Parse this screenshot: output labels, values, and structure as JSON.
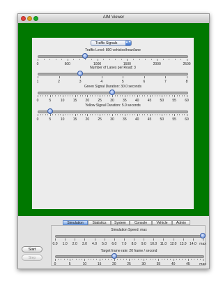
{
  "window": {
    "title": "AIM Viewer"
  },
  "dropdown": {
    "selected": "Traffic Signals",
    "arrows": "▲▼"
  },
  "sliders": [
    {
      "label": "Traffic Level: 800 vehicles/hour/lane",
      "value": 800,
      "min": 0,
      "max": 2500,
      "ticks": [
        "0",
        "500",
        "1000",
        "1500",
        "2000",
        "2500"
      ]
    },
    {
      "label": "Number of Lanes per Road: 3",
      "value": 3,
      "min": 1,
      "max": 8,
      "ticks": [
        "1",
        "2",
        "3",
        "4",
        "5",
        "6",
        "7",
        "8"
      ]
    },
    {
      "label": "Green Signal Duration: 30.0 seconds",
      "value": 30,
      "min": 0,
      "max": 60,
      "ticks": [
        "0",
        "5",
        "10",
        "15",
        "20",
        "25",
        "30",
        "35",
        "40",
        "45",
        "50",
        "55",
        "60"
      ]
    },
    {
      "label": "Yellow Signal Duration: 5.0 seconds",
      "value": 5,
      "min": 0,
      "max": 60,
      "ticks": [
        "0",
        "5",
        "10",
        "15",
        "20",
        "25",
        "30",
        "35",
        "40",
        "45",
        "50",
        "55",
        "60"
      ]
    }
  ],
  "buttons": {
    "start": "Start",
    "step": "Step"
  },
  "tabs": [
    "Simulation",
    "Statistics",
    "System",
    "Console",
    "Vehicle",
    "Admin"
  ],
  "active_tab": "Simulation",
  "speed": {
    "label": "Simulation Speed: max",
    "fraction": 1.0,
    "ticks": [
      "0.0",
      "1.0",
      "2.0",
      "3.0",
      "4.0",
      "5.0",
      "6.0",
      "7.0",
      "8.0",
      "9.0",
      "10.0",
      "11.0",
      "12.0",
      "13.0",
      "14.0",
      "max"
    ]
  },
  "framerate": {
    "label": "Target frame rate: 20 frame / second",
    "value": 20,
    "min": 0,
    "max": 50,
    "ticks": [
      "0",
      "5",
      "10",
      "15",
      "20",
      "25",
      "30",
      "35",
      "40",
      "45",
      "max"
    ]
  }
}
